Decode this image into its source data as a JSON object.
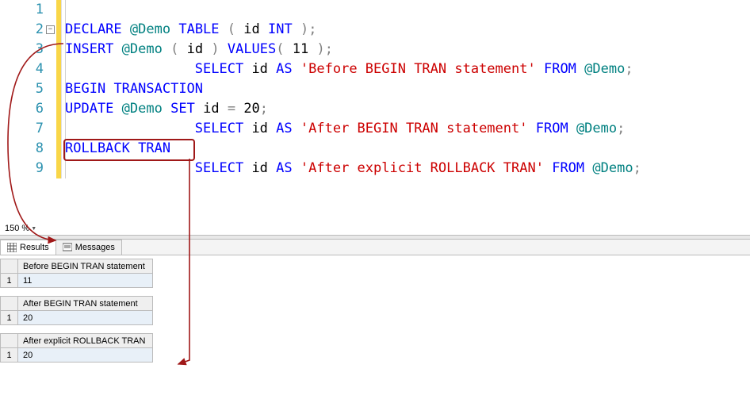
{
  "editor": {
    "lines": [
      1,
      2,
      3,
      4,
      5,
      6,
      7,
      8,
      9
    ],
    "code": {
      "l2": {
        "declare": "DECLARE",
        "var": "@Demo",
        "table": "TABLE",
        "paren1": "(",
        "id": "id",
        "int": "INT",
        "paren2": ")",
        "semi": ";"
      },
      "l3": {
        "insert": "INSERT",
        "var": "@Demo",
        "paren1": "(",
        "id": "id",
        "paren2": ")",
        "values": "VALUES",
        "paren3": "(",
        "num": "11",
        "paren4": ")",
        "semi": ";"
      },
      "l4": {
        "select": "SELECT",
        "id": "id",
        "as": "AS",
        "str": "'Before BEGIN TRAN statement'",
        "from": "FROM",
        "var": "@Demo",
        "semi": ";"
      },
      "l5": {
        "begin": "BEGIN",
        "tran": "TRANSACTION"
      },
      "l6": {
        "update": "UPDATE",
        "var": "@Demo",
        "set": "SET",
        "id": "id",
        "eq": "=",
        "num": "20",
        "semi": ";"
      },
      "l7": {
        "select": "SELECT",
        "id": "id",
        "as": "AS",
        "str": "'After BEGIN TRAN statement'",
        "from": "FROM",
        "var": "@Demo",
        "semi": ";"
      },
      "l8": {
        "rollback": "ROLLBACK",
        "tran": "TRAN"
      },
      "l9": {
        "select": "SELECT",
        "id": "id",
        "as": "AS",
        "str": "'After explicit ROLLBACK TRAN'",
        "from": "FROM",
        "var": "@Demo",
        "semi": ";"
      }
    }
  },
  "zoom": "150 %",
  "tabs": {
    "results": "Results",
    "messages": "Messages"
  },
  "results": [
    {
      "header": "Before BEGIN TRAN statement",
      "rownum": "1",
      "value": "11"
    },
    {
      "header": "After BEGIN TRAN statement",
      "rownum": "1",
      "value": "20"
    },
    {
      "header": "After explicit ROLLBACK TRAN",
      "rownum": "1",
      "value": "20"
    }
  ]
}
